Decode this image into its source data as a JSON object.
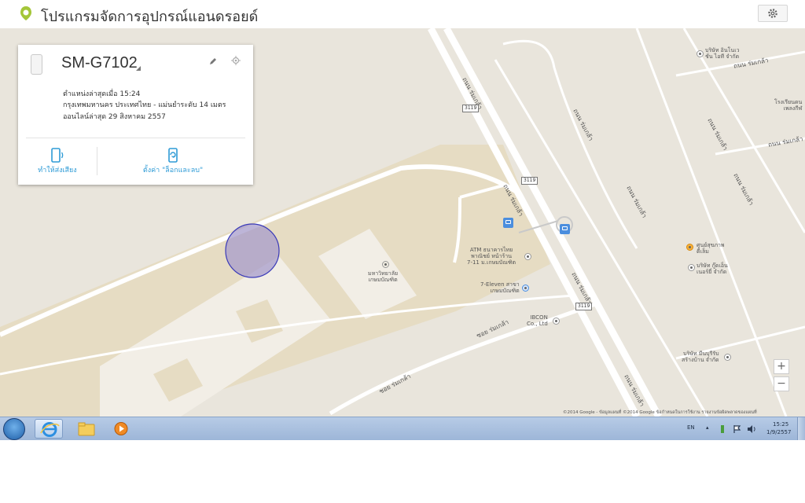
{
  "app": {
    "title": "โปรแกรมจัดการอุปกรณ์แอนดรอยด์",
    "icon": "android-device-manager-icon",
    "settings_icon": "gear-icon"
  },
  "device": {
    "name": "SM-G7102",
    "last_location": "ตำแหน่งล่าสุดเมื่อ 15:24",
    "location_detail": "กรุงเทพมหานคร ประเทศไทย - แม่นยำระดับ 14 เมตร",
    "last_online": "ออนไลน์ล่าสุด 29 สิงหาคม 2557",
    "actions": {
      "ring": "ทำให้ส่งเสียง",
      "lock_erase": "ตั้งค่า \"ล็อกและลบ\""
    }
  },
  "map": {
    "road_labels": [
      "ถนน ร่มเกล้า",
      "ถนน ร่มเกล้า",
      "ถนน ร่มเกล้า",
      "ถนน ร่มเกล้า",
      "ถนน ร่มเกล้า",
      "ถนน ร่มเกล้า",
      "ถนน ร่มเกล้า",
      "ถนน ร่มเกล้า",
      "ถนน ร่มเกล้า",
      "ถนน ร่มเกล้า",
      "ซอย ร่มเกล้า",
      "ซอย ร่มเกล้า"
    ],
    "route_shields": [
      "3119",
      "3119",
      "3119"
    ],
    "places": [
      {
        "name": "บริษัท อินโนเว\nชั่น ไอที จำกัด"
      },
      {
        "name": "โรงเรียนดน\nเพลงกีฬ"
      },
      {
        "name": "ศูนย์สุขภาพ\nดีเล็ม"
      },
      {
        "name": "บริษัท กู๊ดเอ็น\nเนอร์ยี่ จำกัด"
      },
      {
        "name": "ATM ธนาคารไทย\nพาณิชย์ หน้าร้าน\n7-11 ม.เกษมบัณฑิต"
      },
      {
        "name": "มหาวิทยาลัย\nเกษมบัณฑิต"
      },
      {
        "name": "7-Eleven สาขา\nเกษมบัณฑิต"
      },
      {
        "name": "IBCON\nCo., Ltd"
      },
      {
        "name": "บริษัท มีนบุรีรับ\nสร้างบ้าน จำกัด"
      }
    ],
    "zoom_in": "+",
    "zoom_out": "−",
    "copyright": "©2014 Google - ข้อมูลแผนที่ ©2014 Google   ข้อกำหนดในการใช้งาน   รายงานข้อผิดพลาดของแผนที่",
    "colors": {
      "land": "#e9e5dc",
      "campus": "#e6dcc3",
      "road": "#ffffff",
      "accuracy_circle": "#a79ccb",
      "accent": "#2e9bd6"
    }
  },
  "taskbar": {
    "language": "EN",
    "time": "15:25",
    "date": "1/9/2557"
  }
}
